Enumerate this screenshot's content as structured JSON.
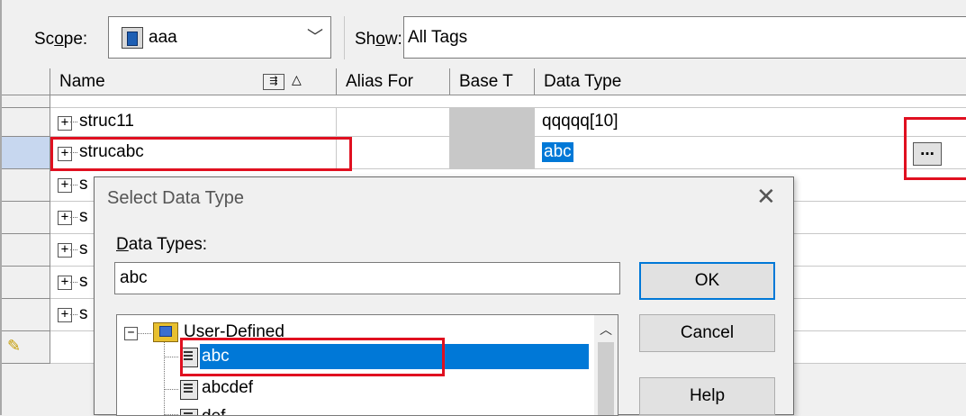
{
  "toolbar": {
    "scope_label": "Scope:",
    "scope_value": "aaa",
    "show_label": "Show:",
    "show_value": "All Tags"
  },
  "grid": {
    "columns": [
      "Name",
      "Alias For",
      "Base T",
      "Data Type"
    ],
    "rows": [
      {
        "name": "struc11",
        "data_type": "qqqqq[10]"
      },
      {
        "name": "strucabc",
        "data_type": "abc"
      },
      {
        "name": "s"
      },
      {
        "name": "s"
      },
      {
        "name": "s"
      },
      {
        "name": "s"
      },
      {
        "name": "s"
      }
    ],
    "ellipsis_button": "..."
  },
  "dialog": {
    "title": "Select Data Type",
    "close": "✕",
    "data_types_label": "Data Types:",
    "input_value": "abc",
    "ok": "OK",
    "cancel": "Cancel",
    "help": "Help",
    "tree": {
      "root": "User-Defined",
      "items": [
        "abc",
        "abcdef",
        "def"
      ]
    }
  },
  "colors": {
    "highlight_red": "#e01020",
    "selection_blue": "#0078d7"
  }
}
